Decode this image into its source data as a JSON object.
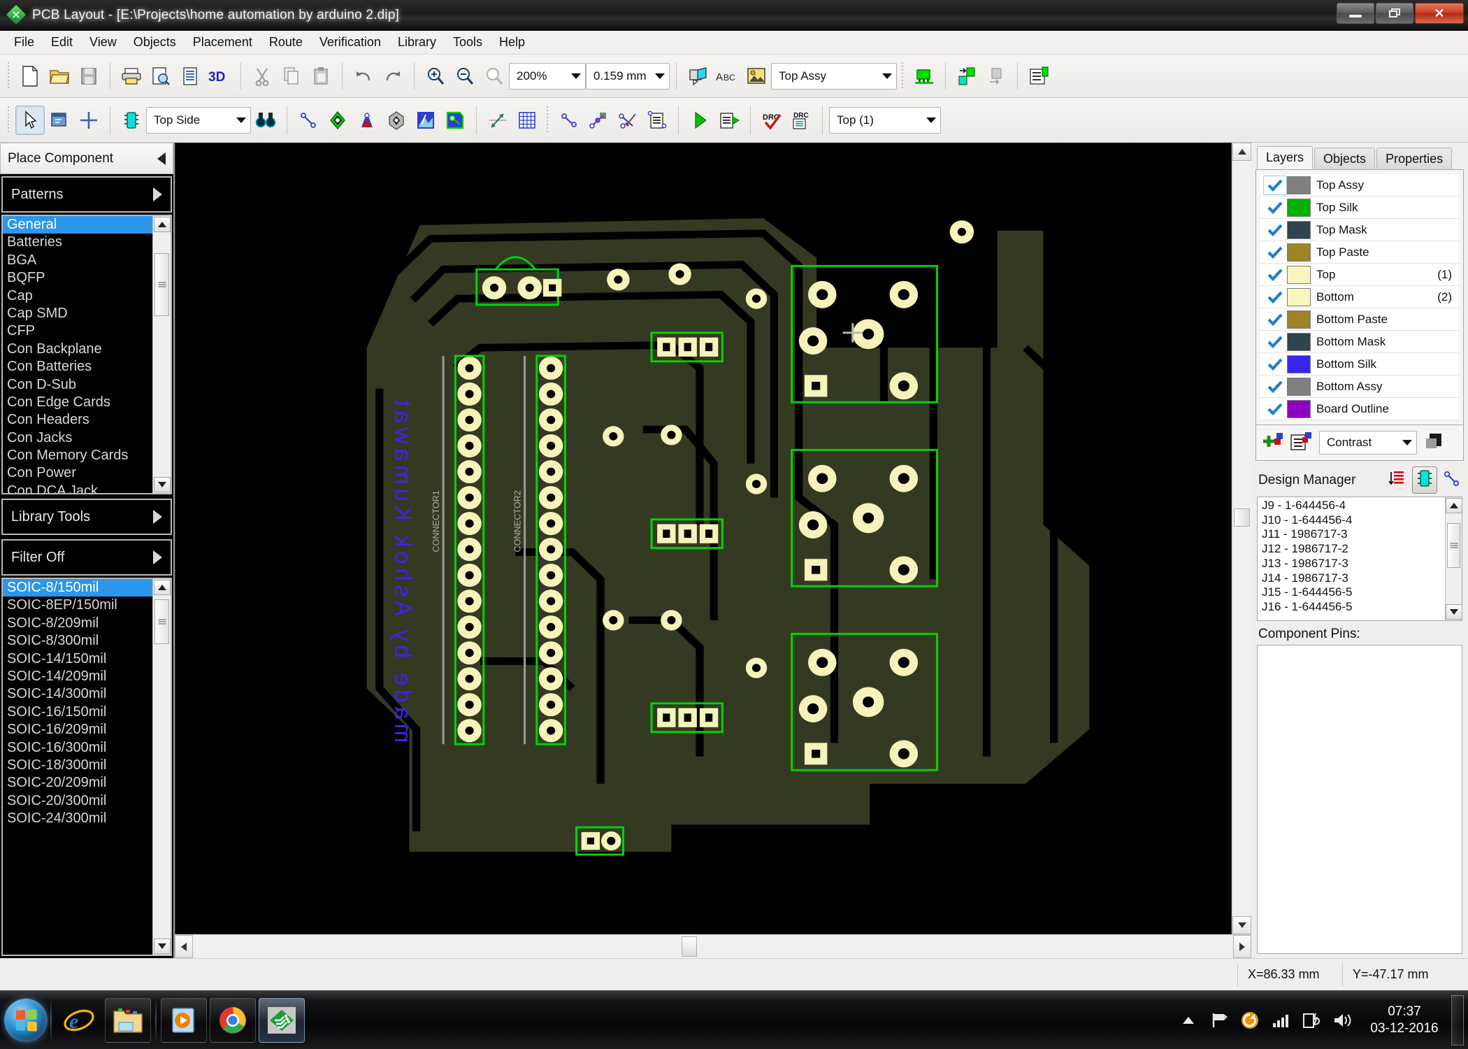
{
  "window": {
    "title": "PCB Layout - [E:\\Projects\\home automation by arduino 2.dip]",
    "app_icon": "pcb-diamond-icon",
    "minimize_label": "Minimize",
    "restore_label": "Restore",
    "close_label": "Close"
  },
  "menu": [
    "File",
    "Edit",
    "View",
    "Objects",
    "Placement",
    "Route",
    "Verification",
    "Library",
    "Tools",
    "Help"
  ],
  "toolbar_main": {
    "buttons": [
      {
        "name": "new-file-icon",
        "label": "New"
      },
      {
        "name": "open-file-icon",
        "label": "Open"
      },
      {
        "name": "save-file-icon",
        "label": "Save"
      },
      {
        "name": "print-icon",
        "label": "Print"
      },
      {
        "name": "print-preview-icon",
        "label": "Print Preview"
      },
      {
        "name": "report-icon",
        "label": "Report"
      },
      {
        "name": "3d-view-icon",
        "label": "3D"
      },
      {
        "name": "cut-icon",
        "label": "Cut"
      },
      {
        "name": "copy-icon",
        "label": "Copy"
      },
      {
        "name": "paste-icon",
        "label": "Paste"
      },
      {
        "name": "undo-icon",
        "label": "Undo"
      },
      {
        "name": "redo-icon",
        "label": "Redo"
      },
      {
        "name": "zoom-in-icon",
        "label": "Zoom In"
      },
      {
        "name": "zoom-out-icon",
        "label": "Zoom Out"
      },
      {
        "name": "zoom-window-icon",
        "label": "Zoom Window"
      }
    ],
    "zoom_value": "200%",
    "grid_value": "0.159 mm",
    "right_buttons": [
      {
        "name": "measure-icon",
        "label": "Measure"
      },
      {
        "name": "text-abc-icon",
        "label": "ABC"
      },
      {
        "name": "image-icon",
        "label": "Image"
      }
    ],
    "assy_layer_value": "Top Assy",
    "tail_buttons": [
      {
        "name": "component-icon",
        "label": "Components"
      },
      {
        "name": "swap-component-icon",
        "label": "Swap"
      },
      {
        "name": "unplace-icon",
        "label": "Unplace"
      },
      {
        "name": "properties-icon",
        "label": "Properties"
      }
    ]
  },
  "toolbar_edit": {
    "select_tool": "select-arrow-icon",
    "component_tool": "place-component-icon",
    "cross_tool": "crosshair-icon",
    "chip_tool": "chip-icon",
    "side_value": "Top Side",
    "find_tool": "binoculars-icon",
    "draw_tools": [
      {
        "name": "line-tool-icon",
        "label": "Line"
      },
      {
        "name": "pad-tool-icon",
        "label": "Pad"
      },
      {
        "name": "via-tool-icon",
        "label": "Via"
      },
      {
        "name": "polygon-tool-icon",
        "label": "Polygon"
      },
      {
        "name": "copper-pour-icon",
        "label": "Copper Pour"
      },
      {
        "name": "keepout-icon",
        "label": "Keepout"
      }
    ],
    "dim_tool": "dimension-icon",
    "grid_tool": "grid-icon",
    "route_tools": [
      {
        "name": "route-manual-icon",
        "label": "Manual Route"
      },
      {
        "name": "route-trace-icon",
        "label": "Trace Route"
      },
      {
        "name": "cut-trace-icon",
        "label": "Cut Trace"
      },
      {
        "name": "route-report-icon",
        "label": "Route Report"
      }
    ],
    "run_tools": [
      {
        "name": "autoroute-play-icon",
        "label": "Autoroute"
      },
      {
        "name": "autoroute-report-icon",
        "label": "Autoroute Report"
      }
    ],
    "drc_tools": [
      {
        "name": "drc-check-icon",
        "label": "DRC Check"
      },
      {
        "name": "drc-report-icon",
        "label": "DRC Report"
      }
    ],
    "layer_value": "Top (1)"
  },
  "left_panel": {
    "header": "Place Component",
    "collapse_icon": "chevron-left-icon",
    "patterns_section": "Patterns",
    "library_tools_section": "Library Tools",
    "filter_section": "Filter Off",
    "expand_icon": "chevron-right-icon",
    "categories": [
      "General",
      "Batteries",
      "BGA",
      "BQFP",
      "Cap",
      "Cap SMD",
      "CFP",
      "Con Backplane",
      "Con Batteries",
      "Con D-Sub",
      "Con Edge Cards",
      "Con Headers",
      "Con Jacks",
      "Con Memory Cards",
      "Con Power",
      "Con DCA Jack"
    ],
    "categories_selected": "General",
    "patterns": [
      "SOIC-8/150mil",
      "SOIC-8EP/150mil",
      "SOIC-8/209mil",
      "SOIC-8/300mil",
      "SOIC-14/150mil",
      "SOIC-14/209mil",
      "SOIC-14/300mil",
      "SOIC-16/150mil",
      "SOIC-16/209mil",
      "SOIC-16/300mil",
      "SOIC-18/300mil",
      "SOIC-20/209mil",
      "SOIC-20/300mil",
      "SOIC-24/300mil"
    ],
    "patterns_selected": "SOIC-8/150mil"
  },
  "right_panel": {
    "tabs": [
      "Layers",
      "Objects",
      "Properties"
    ],
    "active_tab": "Layers",
    "layers": [
      {
        "name": "Top Assy",
        "color": "#808080",
        "visible": true,
        "index": ""
      },
      {
        "name": "Top Silk",
        "color": "#00b200",
        "visible": true,
        "index": ""
      },
      {
        "name": "Top Mask",
        "color": "#2f4350",
        "visible": true,
        "index": ""
      },
      {
        "name": "Top Paste",
        "color": "#9d8426",
        "visible": true,
        "index": ""
      },
      {
        "name": "Top",
        "color": "#f8f6bc",
        "visible": true,
        "index": "(1)"
      },
      {
        "name": "Bottom",
        "color": "#f8f6bc",
        "visible": true,
        "index": "(2)"
      },
      {
        "name": "Bottom Paste",
        "color": "#9d8426",
        "visible": true,
        "index": ""
      },
      {
        "name": "Bottom Mask",
        "color": "#2f4350",
        "visible": true,
        "index": ""
      },
      {
        "name": "Bottom Silk",
        "color": "#3826f0",
        "visible": true,
        "index": ""
      },
      {
        "name": "Bottom Assy",
        "color": "#808080",
        "visible": true,
        "index": ""
      },
      {
        "name": "Board Outline",
        "color": "#9000c0",
        "visible": true,
        "index": ""
      }
    ],
    "layer_tools": [
      {
        "name": "add-layer-icon",
        "label": "Add Layer"
      },
      {
        "name": "layer-properties-icon",
        "label": "Layer Properties"
      }
    ],
    "contrast_value": "Contrast",
    "layer_stack_icon": "layer-stack-icon",
    "design_manager": {
      "title": "Design Manager",
      "tools": [
        {
          "name": "sort-nets-icon",
          "label": "Sort"
        },
        {
          "name": "components-view-icon",
          "label": "Components"
        },
        {
          "name": "nets-view-icon",
          "label": "Nets"
        }
      ],
      "active_tool": "components-view-icon",
      "items": [
        "J9 - 1-644456-4",
        "J10 - 1-644456-4",
        "J11 - 1986717-3",
        "J12 - 1986717-2",
        "J13 - 1986717-3",
        "J14 - 1986717-3",
        "J15 - 1-644456-5",
        "J16 - 1-644456-5"
      ]
    },
    "component_pins_label": "Component Pins:",
    "component_pins": []
  },
  "statusbar": {
    "x": "X=86.33 mm",
    "y": "Y=-47.17 mm"
  },
  "canvas": {
    "board_silk_text": "made by Ashok Kumawat",
    "ref_left": "CONNECTOR1",
    "ref_right": "CONNECTOR2",
    "colors": {
      "background": "#000000",
      "copper_pour": "#343a22",
      "pad": "#f6f3ba",
      "silk": "#00d400",
      "bottom_silk": "#3826f0"
    }
  },
  "taskbar": {
    "start_label": "Start",
    "items": [
      {
        "name": "taskbar-ie-icon",
        "label": "Internet Explorer"
      },
      {
        "name": "taskbar-explorer-icon",
        "label": "Windows Explorer"
      },
      {
        "name": "taskbar-media-player-icon",
        "label": "Windows Media Player"
      },
      {
        "name": "taskbar-chrome-icon",
        "label": "Google Chrome"
      },
      {
        "name": "taskbar-pcb-layout-icon",
        "label": "PCB Layout"
      }
    ],
    "tray": [
      {
        "name": "show-hidden-icons-icon",
        "label": "Show hidden icons"
      },
      {
        "name": "action-center-flag-icon",
        "label": "Action Center"
      },
      {
        "name": "update-icon",
        "label": "Update"
      },
      {
        "name": "network-signal-icon",
        "label": "Network"
      },
      {
        "name": "battery-icon",
        "label": "Battery"
      },
      {
        "name": "volume-icon",
        "label": "Volume"
      }
    ],
    "time": "07:37",
    "date": "03-12-2016"
  }
}
